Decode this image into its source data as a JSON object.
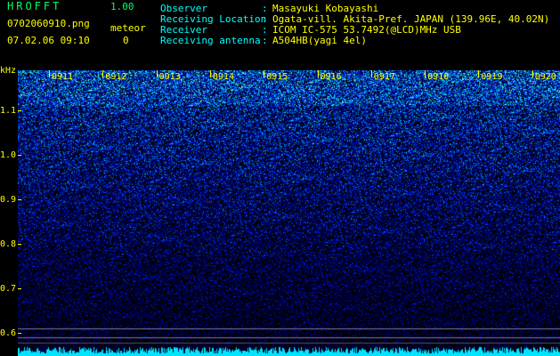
{
  "header": {
    "app_title": "HROFFT",
    "version": "1.00",
    "filename": "0702060910.png",
    "datetime": "07.02.06 09:10",
    "meteor_label": "meteor",
    "meteor_count": "0"
  },
  "info": [
    {
      "label": "Observer",
      "value": "Masayuki Kobayashi"
    },
    {
      "label": "Receiving Location",
      "value": "Ogata-vill. Akita-Pref. JAPAN (139.96E, 40.02N)"
    },
    {
      "label": "Receiver",
      "value": "ICOM IC-575 53.7492(@LCD)MHz USB"
    },
    {
      "label": "Receiving antenna",
      "value": "A504HB(yagi 4el)"
    }
  ],
  "separator": ":",
  "spectrogram": {
    "y_unit": "kHz",
    "y_ticks": [
      "1.1",
      "1.0",
      "0.9",
      "0.8",
      "0.7",
      "0.6"
    ],
    "x_ticks": [
      "0911",
      "0912",
      "0913",
      "0914",
      "0915",
      "0916",
      "0917",
      "0918",
      "0919",
      "0920"
    ],
    "colors": {
      "text_label": "#00ffff",
      "text_value": "#ffff00",
      "title": "#00ff66",
      "tick": "#ffff00"
    }
  }
}
